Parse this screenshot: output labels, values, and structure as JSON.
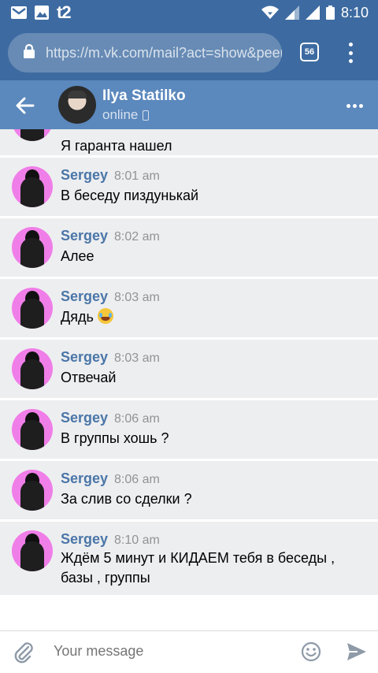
{
  "status_bar": {
    "carrier": "t2",
    "time": "8:10"
  },
  "browser": {
    "url": "https://m.vk.com/mail?act=show&peer",
    "tab_count": "56"
  },
  "header": {
    "name": "Ilya Statilko",
    "status": "online"
  },
  "messages": [
    {
      "sender": "",
      "time": "",
      "text": "Я гаранта нашел",
      "emoji": ""
    },
    {
      "sender": "Sergey",
      "time": "8:01 am",
      "text": "В беседу пиздунькай",
      "emoji": ""
    },
    {
      "sender": "Sergey",
      "time": "8:02 am",
      "text": "Алее",
      "emoji": ""
    },
    {
      "sender": "Sergey",
      "time": "8:03 am",
      "text": "Дядь",
      "emoji": "face-with-tears-of-joy"
    },
    {
      "sender": "Sergey",
      "time": "8:03 am",
      "text": "Отвечай",
      "emoji": ""
    },
    {
      "sender": "Sergey",
      "time": "8:06 am",
      "text": "В группы хошь ?",
      "emoji": ""
    },
    {
      "sender": "Sergey",
      "time": "8:06 am",
      "text": "За слив со сделки ?",
      "emoji": ""
    },
    {
      "sender": "Sergey",
      "time": "8:10 am",
      "text": "Ждём 5 минут и КИДАЕМ тебя в беседы , базы , группы",
      "emoji": ""
    }
  ],
  "composer": {
    "placeholder": "Your message"
  },
  "colors": {
    "statusbar": "#3d6ba1",
    "header": "#5b88bd",
    "message_bg": "#edeef0",
    "sender": "#4a76a8",
    "avatar_bg": "#f07ee8"
  }
}
